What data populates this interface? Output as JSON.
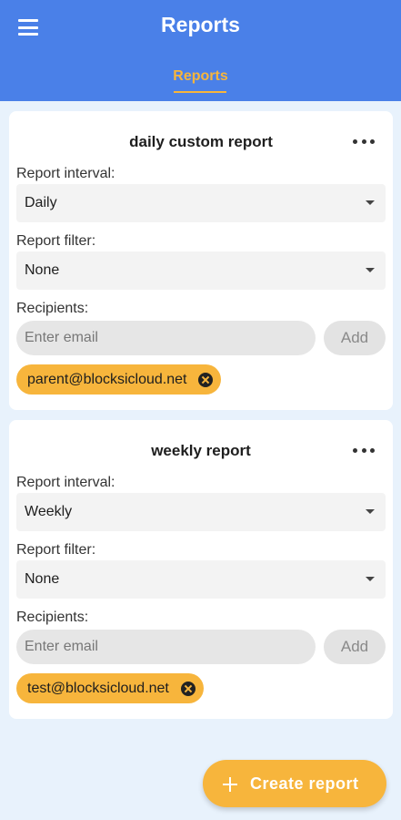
{
  "header": {
    "title": "Reports",
    "active_tab": "Reports"
  },
  "reports": [
    {
      "name": "daily custom report",
      "interval_label": "Report interval:",
      "interval_value": "Daily",
      "filter_label": "Report filter:",
      "filter_value": "None",
      "recipients_label": "Recipients:",
      "email_placeholder": "Enter email",
      "add_label": "Add",
      "recipients": [
        "parent@blocksicloud.net"
      ]
    },
    {
      "name": "weekly report",
      "interval_label": "Report interval:",
      "interval_value": "Weekly",
      "filter_label": "Report filter:",
      "filter_value": "None",
      "recipients_label": "Recipients:",
      "email_placeholder": "Enter email",
      "add_label": "Add",
      "recipients": [
        "test@blocksicloud.net"
      ]
    }
  ],
  "fab": {
    "label": "Create report",
    "icon": "plus-icon"
  },
  "colors": {
    "primary": "#4a80e8",
    "accent": "#f7b53c",
    "background": "#e8f2fc"
  }
}
